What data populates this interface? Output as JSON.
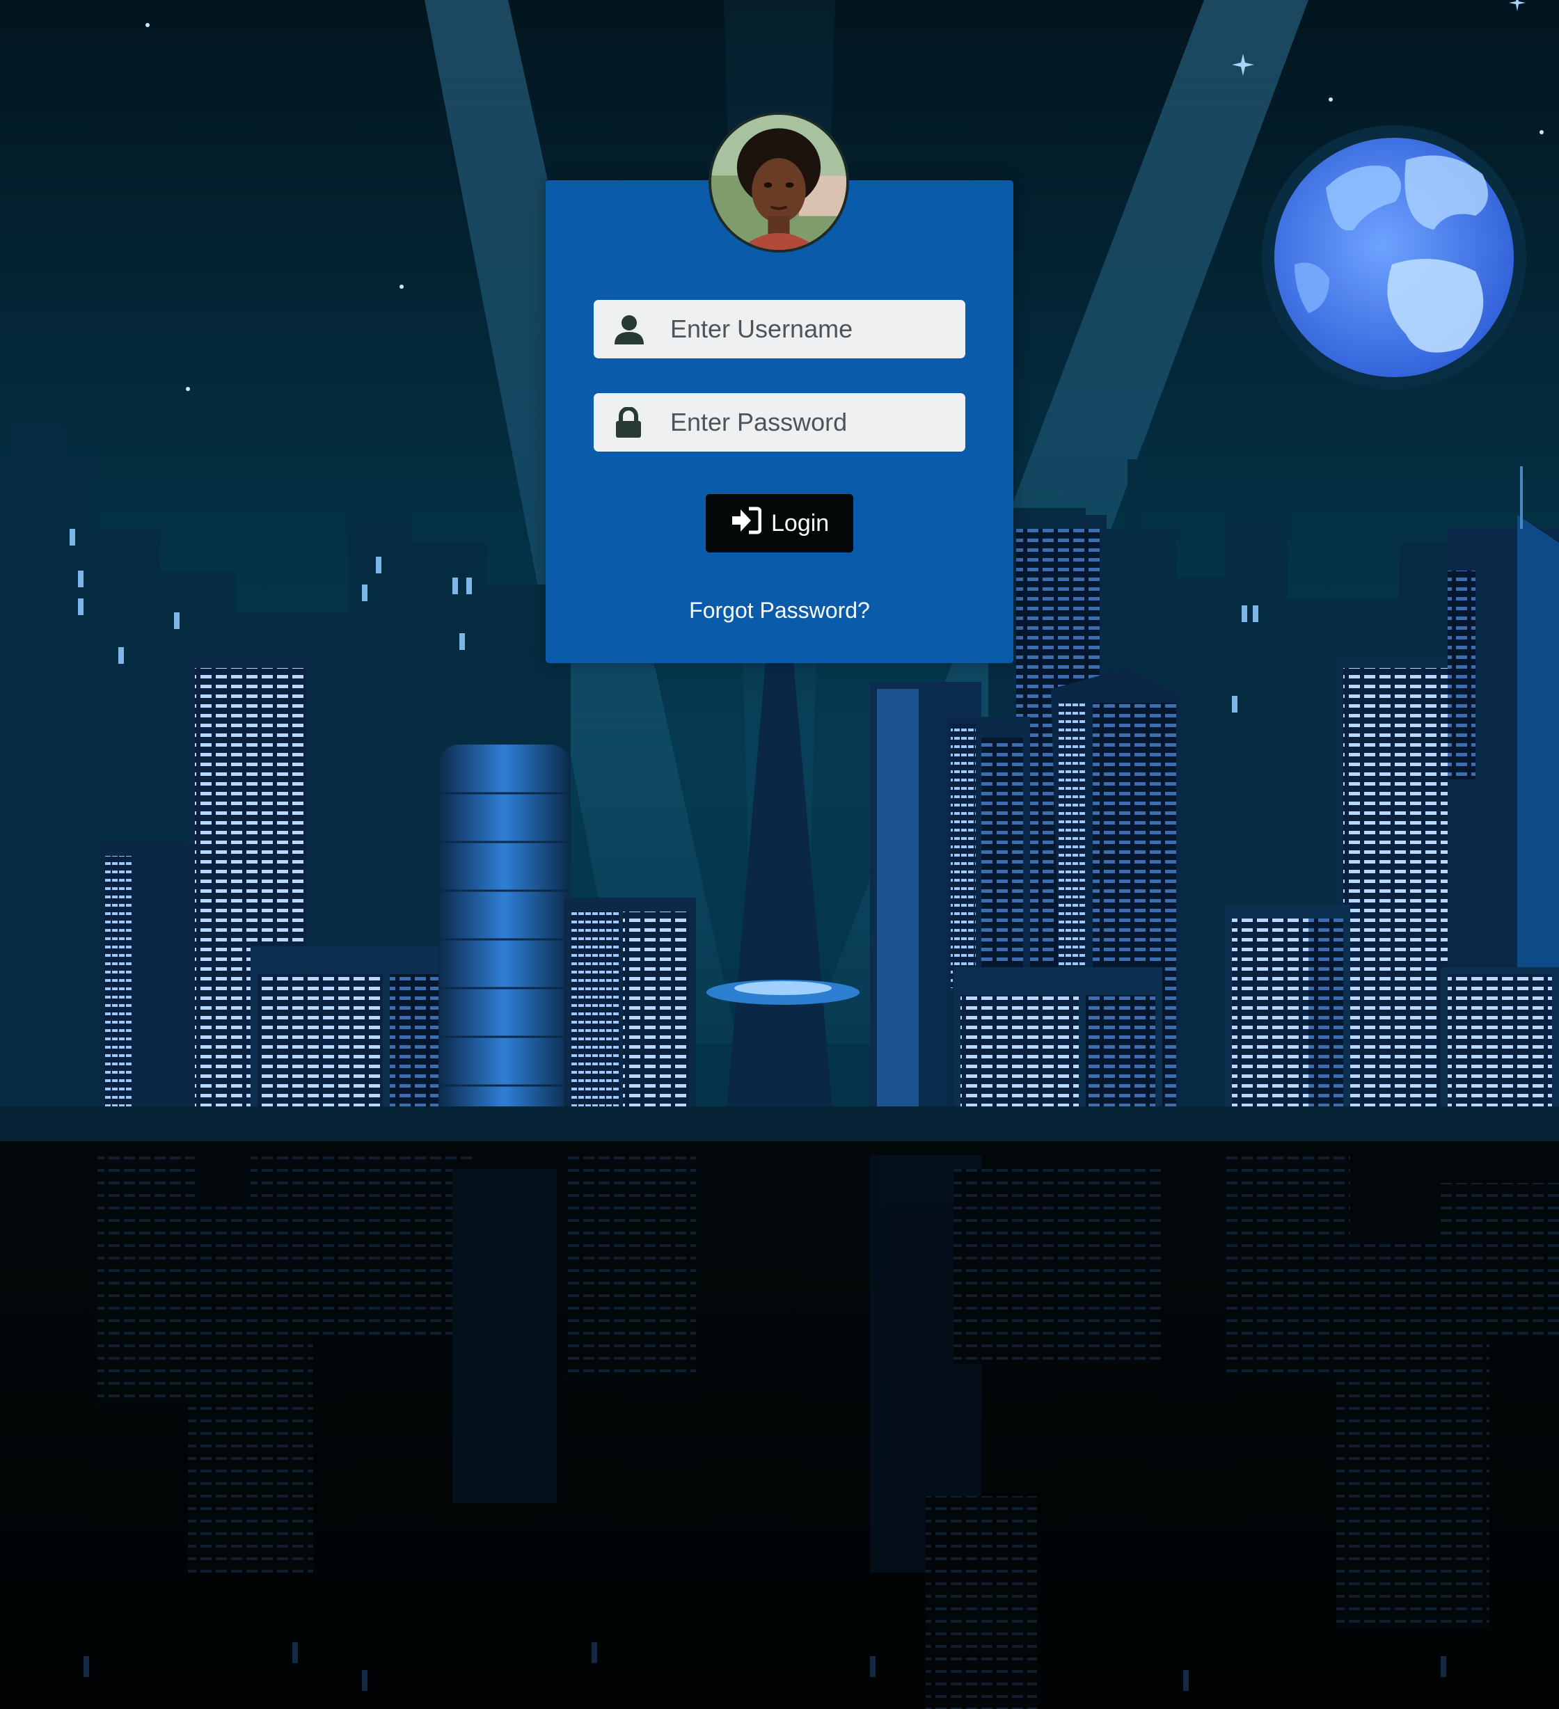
{
  "login_form": {
    "username_placeholder": "Enter Username",
    "password_placeholder": "Enter Password",
    "login_label": "Login",
    "forgot_password_label": "Forgot Password?"
  },
  "icons": {
    "username": "user-icon",
    "password": "lock-icon",
    "login": "sign-in-icon"
  },
  "colors": {
    "panel": "#0b5dad",
    "field_background": "#eef0f1",
    "button": "#050808",
    "link": "#ffffff"
  }
}
